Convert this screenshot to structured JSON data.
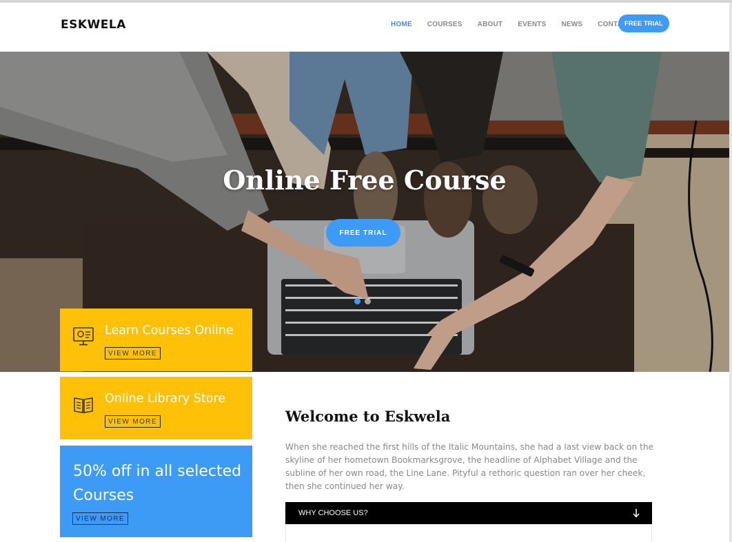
{
  "header": {
    "logo": "ESKWELA",
    "nav": [
      {
        "label": "HOME",
        "active": true
      },
      {
        "label": "COURSES",
        "active": false
      },
      {
        "label": "ABOUT",
        "active": false
      },
      {
        "label": "EVENTS",
        "active": false
      },
      {
        "label": "NEWS",
        "active": false
      },
      {
        "label": "CONTACT",
        "active": false
      }
    ],
    "cta_label": "FREE TRIAL"
  },
  "hero": {
    "title": "Online Free Course",
    "button_label": "FREE TRIAL",
    "slides": 2,
    "active_slide": 1
  },
  "features": [
    {
      "title": "Learn Courses Online",
      "icon": "monitor-icon",
      "button": "VIEW MORE"
    },
    {
      "title": "Online Library Store",
      "icon": "book-icon",
      "button": "VIEW MORE"
    },
    {
      "title": "50% off in all selected Courses",
      "button": "VIEW MORE"
    }
  ],
  "welcome": {
    "title": "Welcome to Eskwela",
    "text": "When she reached the first hills of the Italic Mountains, she had a last view back on the skyline of her hometown Bookmarksgrove, the headline of Alphabet Village and the subline of her own road, the Line Lane. Pityful a rethoric question ran over her cheek, then she continued her way.",
    "accordion_label": "WHY CHOOSE US?",
    "accordion_icon": "arrow-down-icon"
  },
  "colors": {
    "accent": "#3d9bf5",
    "yellow": "#ffc107",
    "dark": "#000000"
  }
}
